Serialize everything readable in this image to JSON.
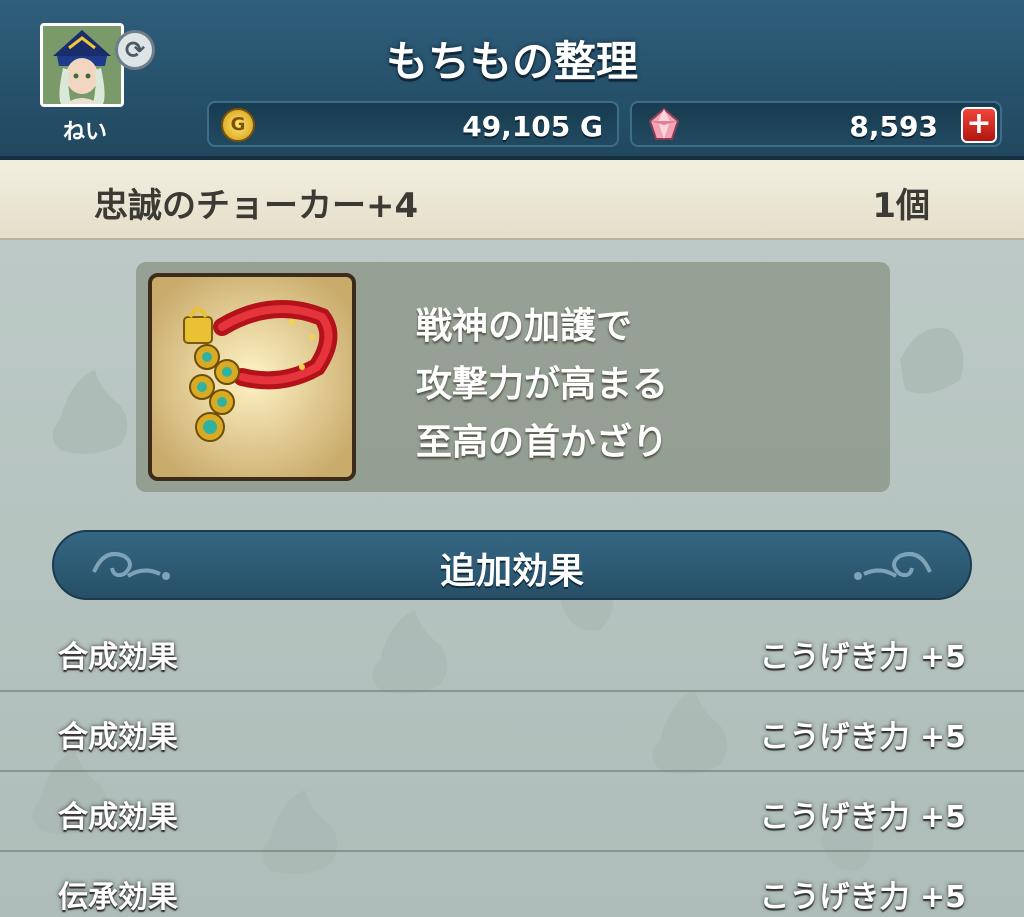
{
  "header": {
    "title": "もちもの整理",
    "player_name": "ねい",
    "refresh_icon": "refresh-icon",
    "gold": "49,105 G",
    "gem": "8,593",
    "plus_label": "+"
  },
  "item": {
    "name": "忠誠のチョーカー+4",
    "count": "1個",
    "description": [
      "戦神の加護で",
      "攻撃力が高まる",
      "至高の首かざり"
    ]
  },
  "effects": {
    "title": "追加効果",
    "rows": [
      {
        "name": "合成効果",
        "value": "こうげき力 +5"
      },
      {
        "name": "合成効果",
        "value": "こうげき力 +5"
      },
      {
        "name": "合成効果",
        "value": "こうげき力 +5"
      },
      {
        "name": "伝承効果",
        "value": "こうげき力 +5"
      }
    ]
  },
  "colors": {
    "header_bg": "#2f5e7c",
    "item_bar_bg": "#f3efe0",
    "section_bg": "#356783",
    "plus_button": "#d8251b"
  },
  "icons": {
    "coin": "gold-coin-icon",
    "gem": "gem-icon",
    "item": "choker-item-icon"
  }
}
